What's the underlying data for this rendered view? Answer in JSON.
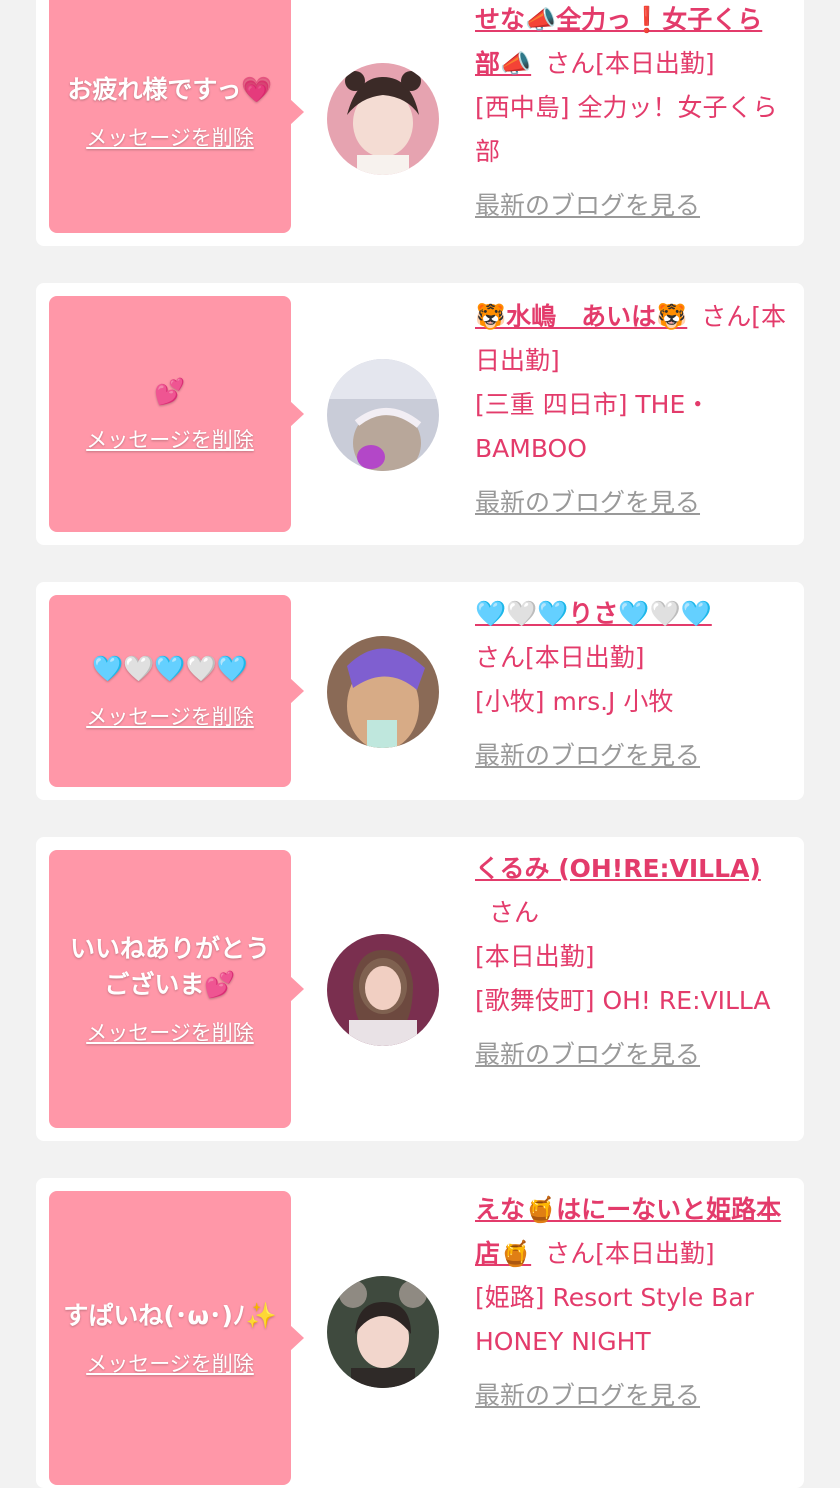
{
  "items": [
    {
      "message": "お疲れ様ですっ💗",
      "delete_label": "メッセージを削除",
      "name": "せな📣全力っ❗️女子くら部📣",
      "san": "さん",
      "status": "[本日出勤]",
      "shop": "[西中島] 全力ッ！女子くら部",
      "blog_label": "最新のブログを見る"
    },
    {
      "message": "💕",
      "delete_label": "メッセージを削除",
      "name": "🐯水嶋　あいは🐯",
      "san": "さん",
      "status": "[本日出勤]",
      "shop": "[三重 四日市] THE・BAMBOO",
      "blog_label": "最新のブログを見る"
    },
    {
      "message": "🩵🤍🩵🤍🩵",
      "delete_label": "メッセージを削除",
      "name": "🩵🤍🩵りさ🩵🤍🩵",
      "san": "さん",
      "status": "[本日出勤]",
      "shop": "[小牧] mrs.J 小牧",
      "blog_label": "最新のブログを見る"
    },
    {
      "message": "いいねありがとうございま💕",
      "delete_label": "メッセージを削除",
      "name": "くるみ (OH!RE:VILLA)",
      "san": "さん",
      "status": "[本日出勤]",
      "shop": "[歌舞伎町] OH! RE:VILLA",
      "blog_label": "最新のブログを見る"
    },
    {
      "message": "すぱいね(･ω･)ﾉ✨",
      "delete_label": "メッセージを削除",
      "name": "えな🍯はにーないと姫路本店🍯",
      "san": "さん",
      "status": "[本日出勤]",
      "shop": "[姫路] Resort Style Bar HONEY NIGHT",
      "blog_label": "最新のブログを見る"
    }
  ],
  "colors": {
    "page_bg": "#f2f2f2",
    "card_bg": "#ffffff",
    "bubble_bg": "#ff97a8",
    "accent_text": "#e33b6b",
    "muted_link": "#999999"
  },
  "icons": [
    "avatar-photo",
    "speech-bubble-pointer"
  ]
}
